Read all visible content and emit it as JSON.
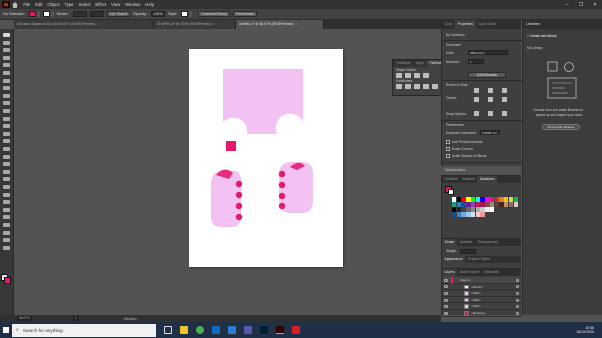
{
  "menubar": {
    "logo": "Ai",
    "items": [
      "File",
      "Edit",
      "Object",
      "Type",
      "Select",
      "Effect",
      "View",
      "Window",
      "Help"
    ],
    "window_controls": [
      "–",
      "❐",
      "✕"
    ]
  },
  "controlbar": {
    "selection_label": "No Selection",
    "fill_color": "#e5196b",
    "stroke_label": "Stroke:",
    "brush": "5 pt. Round",
    "opacity_label": "Opacity:",
    "opacity_value": "100%",
    "style_label": "Style:",
    "doc_setup": "Document Setup",
    "preferences": "Preferences"
  },
  "tabs": [
    {
      "label": "Dinosaur-shapes-at-AI.ai @ 66.67% (CMYK/Preview)",
      "active": false
    },
    {
      "label": "SHAPES.ai* @ 100% (RGB/Preview)",
      "active": false
    },
    {
      "label": "Untitled-1* @ 66.67% (RGB/Preview)",
      "active": true
    }
  ],
  "float_panel": {
    "tabs": [
      "Transform",
      "Align",
      "Pathfinder"
    ],
    "active_tab": "Pathfinder",
    "shape_modes": "Shape Modes:",
    "pathfinders": "Pathfinders:",
    "expand": "Expand"
  },
  "properties": {
    "tabs": [
      "Color",
      "Properties",
      "Color Guide"
    ],
    "active_tab": "Properties",
    "no_selection": "No Selection",
    "document": "Document",
    "units_label": "Units:",
    "units_value": "Millimeters",
    "artboard_label": "Artboard:",
    "artboard_value": "1",
    "edit_artboards": "Edit Artboards",
    "rulers_grids": "Rulers & Grids",
    "guides": "Guides",
    "snap_options": "Snap Options",
    "preferences": "Preferences",
    "keyboard_increment_label": "Keyboard Increment:",
    "keyboard_increment_value": "0.3528 mm",
    "checks": [
      "Use Preview Bounds",
      "Scale Corners",
      "Scale Strokes & Effects"
    ],
    "quick_actions": "Quick Actions"
  },
  "swatches_panel": {
    "tabs": [
      "Gradient",
      "Brushes",
      "Swatches"
    ],
    "active_tab": "Swatches",
    "grid_colors": [
      [
        "#ffffff",
        "#000000",
        "#ff0000",
        "#ffff00",
        "#00ff00",
        "#00ffff",
        "#0000ff",
        "#ff00ff",
        "#e5196b",
        "#c0392b",
        "#e67e22",
        "#f1c40f",
        "#d4e157",
        "#27ae60"
      ],
      [
        "#16a085",
        "#2980b9",
        "#1f4e9c",
        "#6a1b9a",
        "#8e44ad",
        "#c2185b",
        "#ad1457",
        "#795548",
        "#a1887f",
        "#5d4037",
        "#3e2723",
        "#bf8f5f",
        "#8d6e63",
        "#cfcfcf"
      ],
      [
        "#000000",
        "#222222",
        "#444444",
        "#666666",
        "#888888",
        "#aaaaaa",
        "#cccccc",
        "#eeeeee",
        "#ffffff",
        "#3f3f3f",
        "#3f3f3f",
        "#3f3f3f",
        "#3f3f3f",
        "#3f3f3f"
      ],
      [
        "#0b5394",
        "#3d85c6",
        "#6fa8dc",
        "#9fc5e8",
        "#cfe2f3",
        "#f4cccc",
        "#ea9999",
        "#3f3f3f",
        "#3f3f3f",
        "#3f3f3f",
        "#3f3f3f",
        "#3f3f3f",
        "#3f3f3f",
        "#3f3f3f"
      ]
    ]
  },
  "stroke_panel": {
    "tabs": [
      "Stroke",
      "Gradient",
      "Transparency"
    ],
    "weight_label": "Weight:"
  },
  "appearance_panel": {
    "tabs": [
      "Appearance",
      "Graphic Styles"
    ]
  },
  "layers_panel": {
    "tabs": [
      "Layers",
      "Asset Export",
      "Artboards"
    ],
    "rows": [
      "Layer 1",
      "<Group>",
      "<Path>",
      "<Path>",
      "<Path>",
      "<Rectang..."
    ]
  },
  "libraries": {
    "title": "Libraries",
    "create_new": "Create new library",
    "my_library": "My Library",
    "desc_line1": "Choose from pre-made libraries to",
    "desc_line2": "speed up and inspire your work.",
    "find_button": "Find public libraries"
  },
  "status": {
    "zoom": "66.67%",
    "artboard": "1",
    "selection_tool": "Selection"
  },
  "taskbar": {
    "search_placeholder": "Search for anything",
    "time": "15:56",
    "date": "06/12/2020"
  },
  "artwork": {
    "pink_light": "#f3c1f2",
    "pink_hot": "#e5196b",
    "accent_red": "#ff1a66"
  }
}
